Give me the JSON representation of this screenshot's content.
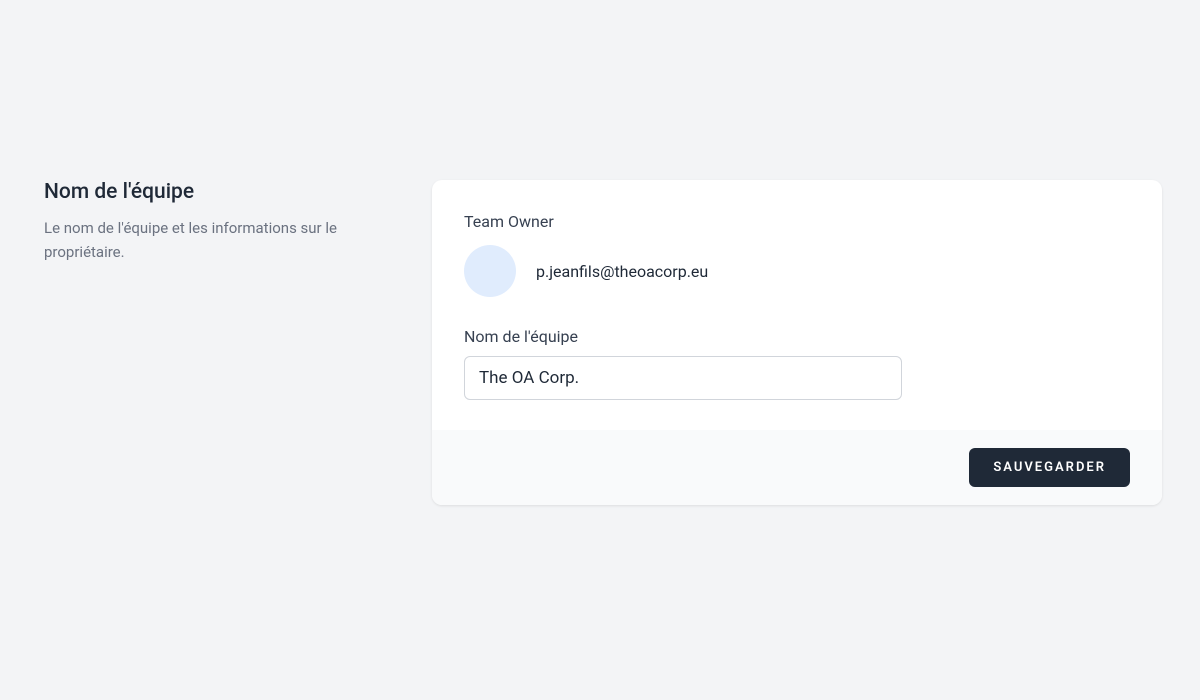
{
  "sidebar": {
    "title": "Nom de l'équipe",
    "description": "Le nom de l'équipe et les informations sur le propriétaire."
  },
  "card": {
    "owner_label": "Team Owner",
    "owner_email": "p.jeanfils@theoacorp.eu",
    "team_name_label": "Nom de l'équipe",
    "team_name_value": "The OA Corp.",
    "save_button_label": "Sauvegarder"
  }
}
